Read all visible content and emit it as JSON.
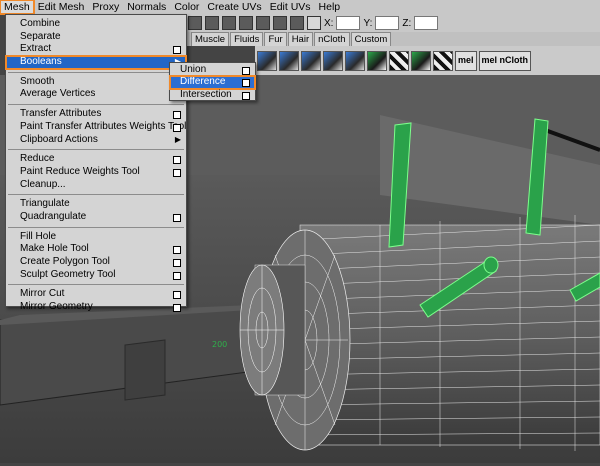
{
  "menubar": {
    "items": [
      {
        "label": "Mesh"
      },
      {
        "label": "Edit Mesh"
      },
      {
        "label": "Proxy"
      },
      {
        "label": "Normals"
      },
      {
        "label": "Color"
      },
      {
        "label": "Create UVs"
      },
      {
        "label": "Edit UVs"
      },
      {
        "label": "Help"
      }
    ]
  },
  "coords": {
    "x": "X:",
    "y": "Y:",
    "z": "Z:"
  },
  "shelf_tabs": [
    {
      "label": "Muscle"
    },
    {
      "label": "Fluids"
    },
    {
      "label": "Fur"
    },
    {
      "label": "Hair"
    },
    {
      "label": "nCloth"
    },
    {
      "label": "Custom"
    }
  ],
  "shelf": {
    "mel1": "mel",
    "mel2": "mel",
    "ncloth": "nCloth"
  },
  "viewport": {
    "readout": "200"
  },
  "mesh_menu": {
    "items": [
      {
        "label": "Combine"
      },
      {
        "label": "Separate"
      },
      {
        "label": "Extract"
      },
      {
        "label": "Booleans"
      },
      {
        "label": "Smooth"
      },
      {
        "label": "Average Vertices"
      },
      {
        "label": "Transfer Attributes"
      },
      {
        "label": "Paint Transfer Attributes Weights Tool"
      },
      {
        "label": "Clipboard Actions"
      },
      {
        "label": "Reduce"
      },
      {
        "label": "Paint Reduce Weights Tool"
      },
      {
        "label": "Cleanup..."
      },
      {
        "label": "Triangulate"
      },
      {
        "label": "Quadrangulate"
      },
      {
        "label": "Fill Hole"
      },
      {
        "label": "Make Hole Tool"
      },
      {
        "label": "Create Polygon Tool"
      },
      {
        "label": "Sculpt Geometry Tool"
      },
      {
        "label": "Mirror Cut"
      },
      {
        "label": "Mirror Geometry"
      }
    ]
  },
  "booleans_submenu": {
    "items": [
      {
        "label": "Union"
      },
      {
        "label": "Difference"
      },
      {
        "label": "Intersection"
      }
    ]
  }
}
